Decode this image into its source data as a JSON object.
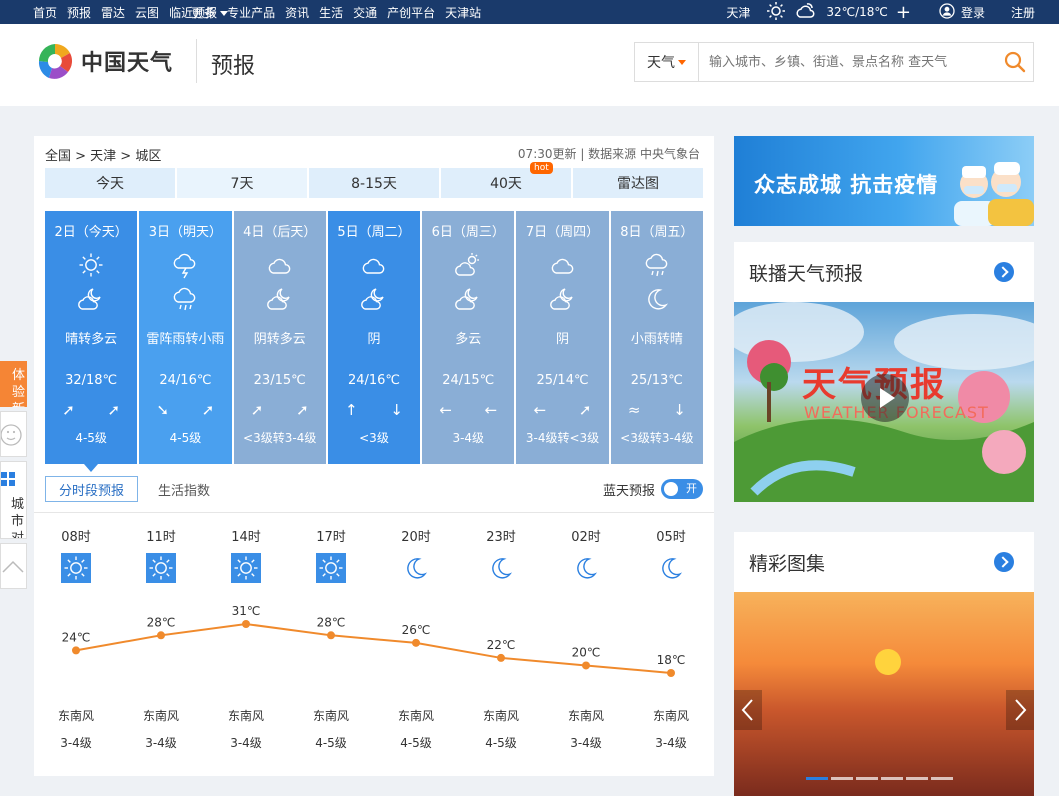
{
  "topnav": {
    "items": [
      "首页",
      "预报",
      "雷达",
      "云图",
      "临近预报",
      "专业产品",
      "资讯",
      "生活",
      "交通",
      "产创平台",
      "天津站"
    ],
    "more": "更多",
    "city": "天津",
    "temp": "32℃/18℃",
    "login": "登录",
    "register": "注册"
  },
  "header": {
    "logo_text": "中国天气",
    "section": "预报",
    "search_type": "天气",
    "search_placeholder": "输入城市、乡镇、街道、景点名称 查天气"
  },
  "breadcrumb": {
    "path": "全国 > 天津 > 城区",
    "meta": "07:30更新 | 数据来源 中央气象台"
  },
  "tabs": [
    {
      "label": "今天"
    },
    {
      "label": "7天",
      "active": true
    },
    {
      "label": "8-15天"
    },
    {
      "label": "40天",
      "badge": "hot"
    },
    {
      "label": "雷达图"
    }
  ],
  "days": [
    {
      "date": "2日（今天）",
      "icon1": "sun",
      "icon2": "partly-cloudy-night",
      "weather": "晴转多云",
      "temp": "32/18℃",
      "arrows": "➚ ➚",
      "wind": "4-5级",
      "color": "#3a8ee6",
      "selected": true
    },
    {
      "date": "3日（明天）",
      "icon1": "thunder",
      "icon2": "rain",
      "weather": "雷阵雨转小雨",
      "temp": "24/16℃",
      "arrows": "➘ ➚",
      "wind": "4-5级",
      "color": "#4aa0ef"
    },
    {
      "date": "4日（后天）",
      "icon1": "cloud",
      "icon2": "partly-cloudy-night",
      "weather": "阴转多云",
      "temp": "23/15℃",
      "arrows": "➚ ➚",
      "wind": "<3级转3-4级",
      "color": "#8aaed6"
    },
    {
      "date": "5日（周二）",
      "icon1": "cloud",
      "icon2": "partly-cloudy-night",
      "weather": "阴",
      "temp": "24/16℃",
      "arrows": "↑ ↓",
      "wind": "<3级",
      "color": "#3a8ee6"
    },
    {
      "date": "6日（周三）",
      "icon1": "partly-cloudy-day",
      "icon2": "partly-cloudy-night",
      "weather": "多云",
      "temp": "24/15℃",
      "arrows": "← ←",
      "wind": "3-4级",
      "color": "#8aaed6"
    },
    {
      "date": "7日（周四）",
      "icon1": "cloud",
      "icon2": "partly-cloudy-night",
      "weather": "阴",
      "temp": "25/14℃",
      "arrows": "← ➚",
      "wind": "3-4级转<3级",
      "color": "#8aaed6"
    },
    {
      "date": "8日（周五）",
      "icon1": "rain",
      "icon2": "moon",
      "weather": "小雨转晴",
      "temp": "25/13℃",
      "arrows": "≈ ↓",
      "wind": "<3级转3-4级",
      "color": "#8aaed6"
    }
  ],
  "subtabs": {
    "active": "分时段预报",
    "other": "生活指数",
    "bluesky": "蓝天预报",
    "toggle": "开"
  },
  "hourly": [
    {
      "time": "08时",
      "icon": "sun",
      "temp": 24,
      "temp_label": "24℃",
      "wind_dir": "东南风",
      "wind": "3-4级"
    },
    {
      "time": "11时",
      "icon": "sun",
      "temp": 28,
      "temp_label": "28℃",
      "wind_dir": "东南风",
      "wind": "3-4级"
    },
    {
      "time": "14时",
      "icon": "sun",
      "temp": 31,
      "temp_label": "31℃",
      "wind_dir": "东南风",
      "wind": "3-4级"
    },
    {
      "time": "17时",
      "icon": "sun",
      "temp": 28,
      "temp_label": "28℃",
      "wind_dir": "东南风",
      "wind": "4-5级"
    },
    {
      "time": "20时",
      "icon": "moon",
      "temp": 26,
      "temp_label": "26℃",
      "wind_dir": "东南风",
      "wind": "4-5级"
    },
    {
      "time": "23时",
      "icon": "moon",
      "temp": 22,
      "temp_label": "22℃",
      "wind_dir": "东南风",
      "wind": "4-5级"
    },
    {
      "time": "02时",
      "icon": "moon",
      "temp": 20,
      "temp_label": "20℃",
      "wind_dir": "东南风",
      "wind": "3-4级"
    },
    {
      "time": "05时",
      "icon": "moon",
      "temp": 18,
      "temp_label": "18℃",
      "wind_dir": "东南风",
      "wind": "3-4级"
    }
  ],
  "sidebar": {
    "banner": "众志成城 抗击疫情",
    "video_card_title": "联播天气预报",
    "video_title": "天气预报",
    "video_subtitle": "WEATHER FORECAST",
    "gallery_title": "精彩图集"
  },
  "float": {
    "a": "体验新版",
    "b": "城市对比"
  },
  "colors": {
    "nav": "#1a3a6b",
    "accent": "#3a8ee6",
    "line": "#f08a2c",
    "orange": "#f58535"
  }
}
